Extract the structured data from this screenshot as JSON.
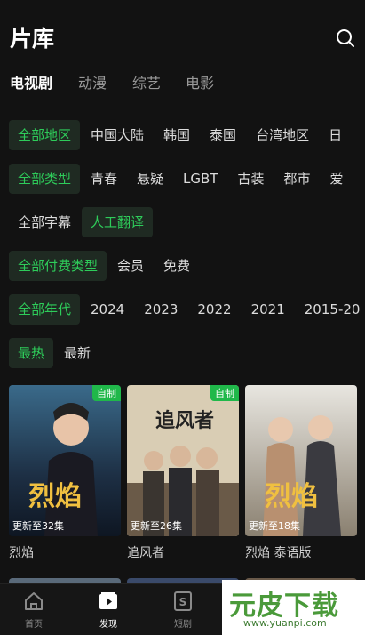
{
  "header": {
    "title": "片库",
    "search_icon": "search-icon"
  },
  "tabs": [
    {
      "label": "电视剧",
      "active": true
    },
    {
      "label": "动漫",
      "active": false
    },
    {
      "label": "综艺",
      "active": false
    },
    {
      "label": "电影",
      "active": false
    }
  ],
  "filters": {
    "region": [
      "全部地区",
      "中国大陆",
      "韩国",
      "泰国",
      "台湾地区",
      "日"
    ],
    "genre": [
      "全部类型",
      "青春",
      "悬疑",
      "LGBT",
      "古装",
      "都市",
      "爱"
    ],
    "subtitle": [
      "全部字幕",
      "人工翻译"
    ],
    "pay": [
      "全部付费类型",
      "会员",
      "免费"
    ],
    "year": [
      "全部年代",
      "2024",
      "2023",
      "2022",
      "2021",
      "2015-20"
    ],
    "sort": [
      "最热",
      "最新"
    ]
  },
  "cards": [
    {
      "title": "烈焰",
      "badge": "自制",
      "progress": "更新至32集",
      "art_text": "烈焰"
    },
    {
      "title": "追风者",
      "badge": "自制",
      "progress": "更新至26集",
      "art_text": "追风者"
    },
    {
      "title": "烈焰 泰语版",
      "badge": "",
      "progress": "更新至18集",
      "art_text": "烈焰"
    }
  ],
  "bottom_nav": [
    {
      "label": "首页",
      "icon": "home-icon",
      "active": false
    },
    {
      "label": "发现",
      "icon": "play-icon",
      "active": true
    },
    {
      "label": "短剧",
      "icon": "short-drama-icon",
      "active": false
    }
  ],
  "watermark": {
    "main": "元皮下载",
    "url": "www.yuanpi.com"
  },
  "colors": {
    "accent": "#2ecc5a",
    "badge": "#20b84a",
    "background": "#121212"
  }
}
